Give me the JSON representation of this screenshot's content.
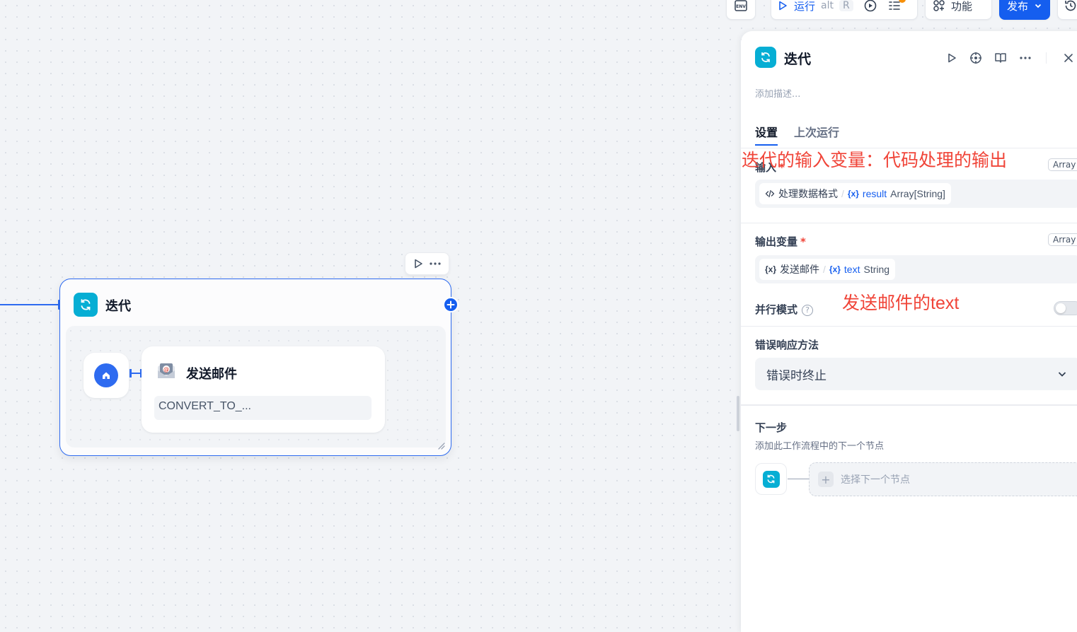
{
  "toolbar": {
    "env_label": "ENV",
    "run_label": "运行",
    "run_shortcut_mod": "alt",
    "run_shortcut_key": "R",
    "features_label": "功能",
    "publish_label": "发布"
  },
  "canvas": {
    "iteration_node": {
      "title": "迭代",
      "child_node": {
        "title": "发送邮件",
        "subtitle": "CONVERT_TO_..."
      }
    }
  },
  "panel": {
    "title": "迭代",
    "description_placeholder": "添加描述...",
    "tabs": [
      "设置",
      "上次运行"
    ],
    "input": {
      "label": "输入",
      "required_mark": "*",
      "type_tag": "Array",
      "source_node": "处理数据格式",
      "separator": "/",
      "var_prefix": "{x}",
      "var_name": "result",
      "var_type": "Array[String]"
    },
    "output": {
      "label": "输出变量",
      "required_mark": "*",
      "type_tag": "Array",
      "source_prefix": "{x}",
      "source_node": "发送邮件",
      "separator": "/",
      "var_prefix": "{x}",
      "var_name": "text",
      "var_type": "String"
    },
    "parallel_mode": {
      "label": "并行模式",
      "help_glyph": "?",
      "enabled": false
    },
    "error_handling": {
      "label": "错误响应方法",
      "selected": "错误时终止"
    },
    "next_step": {
      "label": "下一步",
      "description": "添加此工作流程中的下一个节点",
      "placeholder": "选择下一个节点",
      "plus_glyph": "+"
    }
  },
  "annotations": {
    "input_note": "迭代的输入变量：代码处理的输出",
    "output_note": "发送邮件的text"
  },
  "colors": {
    "accent": "#155eef",
    "iteration_icon": "#06aed4",
    "annotation": "#f04438"
  }
}
